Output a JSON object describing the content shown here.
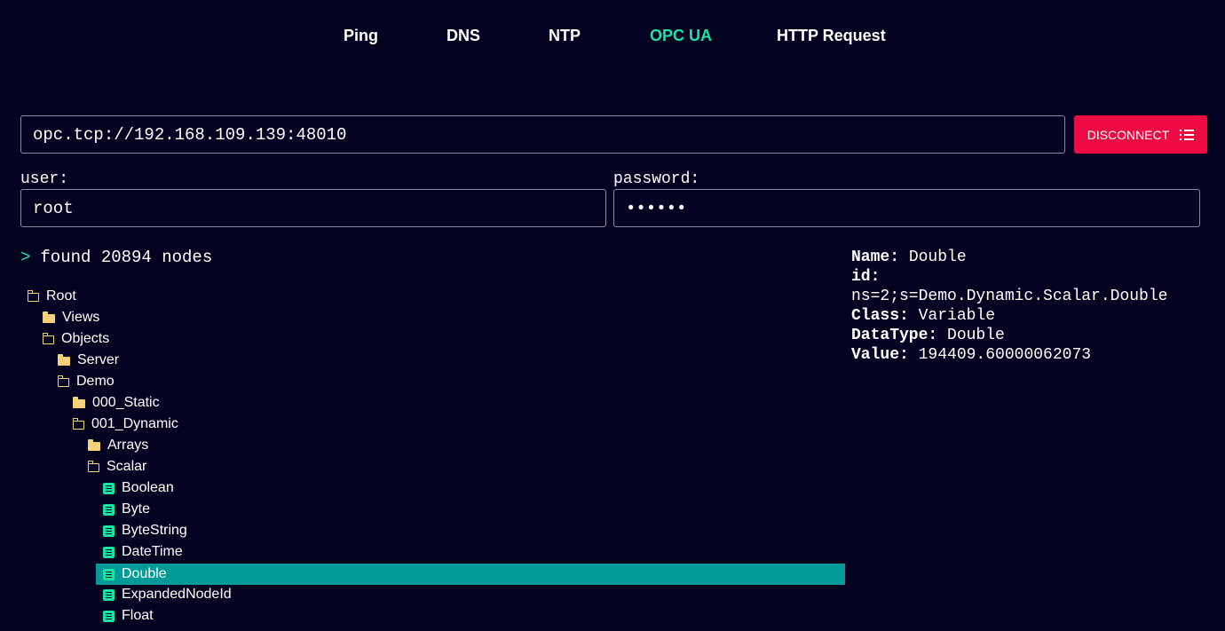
{
  "nav": {
    "tabs": [
      {
        "label": "Ping",
        "active": false
      },
      {
        "label": "DNS",
        "active": false
      },
      {
        "label": "NTP",
        "active": false
      },
      {
        "label": "OPC UA",
        "active": true
      },
      {
        "label": "HTTP Request",
        "active": false
      }
    ]
  },
  "connection": {
    "url": "opc.tcp://192.168.109.139:48010",
    "disconnect_label": "DISCONNECT",
    "disconnect_icon": "list-icon",
    "user_label": "user:",
    "user_value": "root",
    "password_label": "password:",
    "password_value": "••••••"
  },
  "status": {
    "prompt": ">",
    "message": "found 20894 nodes"
  },
  "tree": {
    "nodes": [
      {
        "label": "Root",
        "icon": "folder-open-icon",
        "depth": 0
      },
      {
        "label": "Views",
        "icon": "folder-closed-icon",
        "depth": 1
      },
      {
        "label": "Objects",
        "icon": "folder-open-icon",
        "depth": 1
      },
      {
        "label": "Server",
        "icon": "folder-closed-icon",
        "depth": 2
      },
      {
        "label": "Demo",
        "icon": "folder-open-icon",
        "depth": 2
      },
      {
        "label": "000_Static",
        "icon": "folder-closed-icon",
        "depth": 3
      },
      {
        "label": "001_Dynamic",
        "icon": "folder-open-icon",
        "depth": 3
      },
      {
        "label": "Arrays",
        "icon": "folder-closed-icon",
        "depth": 4
      },
      {
        "label": "Scalar",
        "icon": "folder-open-icon",
        "depth": 4
      },
      {
        "label": "Boolean",
        "icon": "variable-doc-icon",
        "depth": 5
      },
      {
        "label": "Byte",
        "icon": "variable-doc-icon",
        "depth": 5
      },
      {
        "label": "ByteString",
        "icon": "variable-doc-icon",
        "depth": 5
      },
      {
        "label": "DateTime",
        "icon": "variable-doc-icon",
        "depth": 5
      },
      {
        "label": "Double",
        "icon": "variable-doc-icon",
        "depth": 5,
        "selected": true
      },
      {
        "label": "ExpandedNodeId",
        "icon": "variable-doc-icon",
        "depth": 5
      },
      {
        "label": "Float",
        "icon": "variable-doc-icon",
        "depth": 5
      }
    ]
  },
  "details": {
    "name_key": "Name:",
    "name_value": "Double",
    "id_key": "id:",
    "id_value": "ns=2;s=Demo.Dynamic.Scalar.Double",
    "class_key": "Class:",
    "class_value": "Variable",
    "datatype_key": "DataType:",
    "datatype_value": "Double",
    "value_key": "Value:",
    "value_value": "194409.60000062073"
  },
  "colors": {
    "background": "#030221",
    "accent": "#19e3a4",
    "disconnect": "#ee0b44",
    "selected_row": "#009b98",
    "folder": "#f4d27a"
  }
}
